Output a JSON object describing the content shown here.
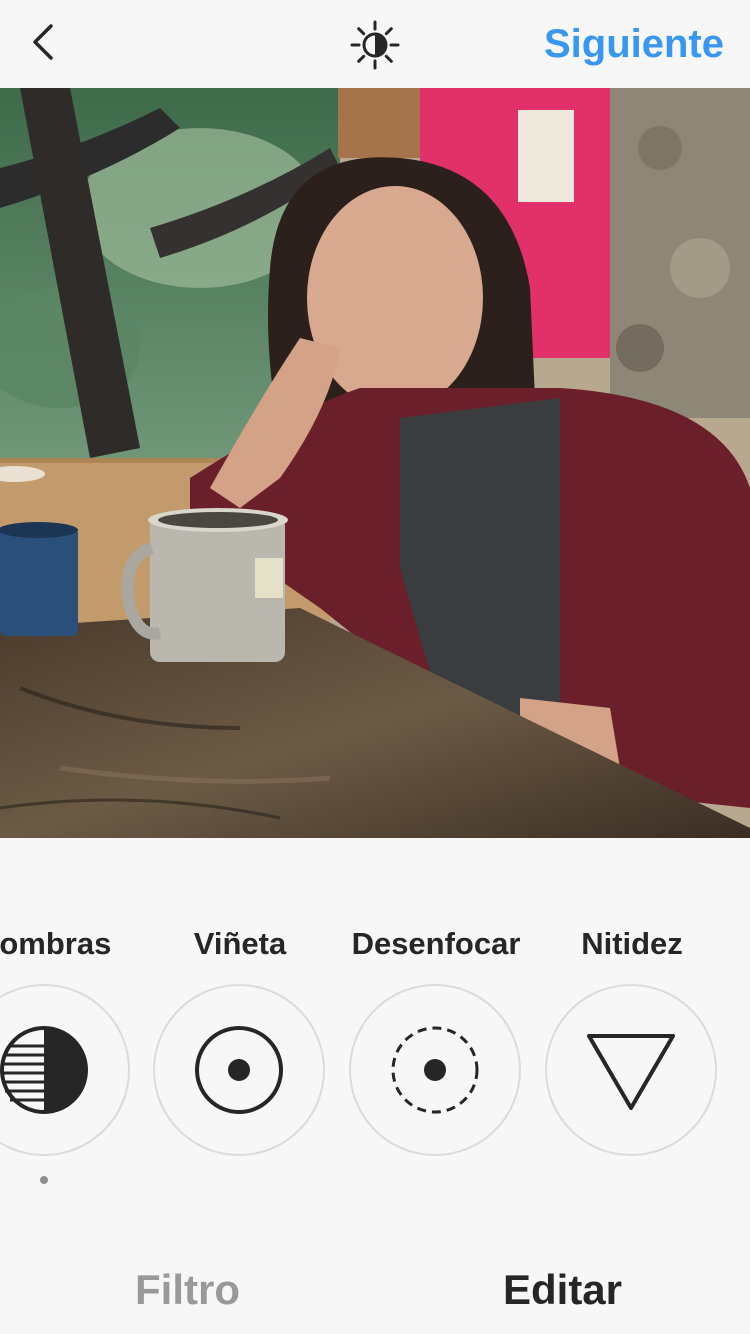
{
  "header": {
    "back_icon": "chevron-left-icon",
    "lux_icon": "lux-sun-icon",
    "next_label": "Siguiente",
    "accent_color": "#3897f0"
  },
  "photo": {
    "description_icon": "photo-preview"
  },
  "tools": {
    "items": [
      {
        "label": "Sombras",
        "icon": "shadows-icon",
        "active": true
      },
      {
        "label": "Viñeta",
        "icon": "vignette-icon",
        "active": false
      },
      {
        "label": "Desenfocar",
        "icon": "tilt-shift-icon",
        "active": false
      },
      {
        "label": "Nitidez",
        "icon": "sharpen-icon",
        "active": false
      }
    ]
  },
  "tabs": {
    "filter_label": "Filtro",
    "edit_label": "Editar",
    "selected": "Editar"
  }
}
